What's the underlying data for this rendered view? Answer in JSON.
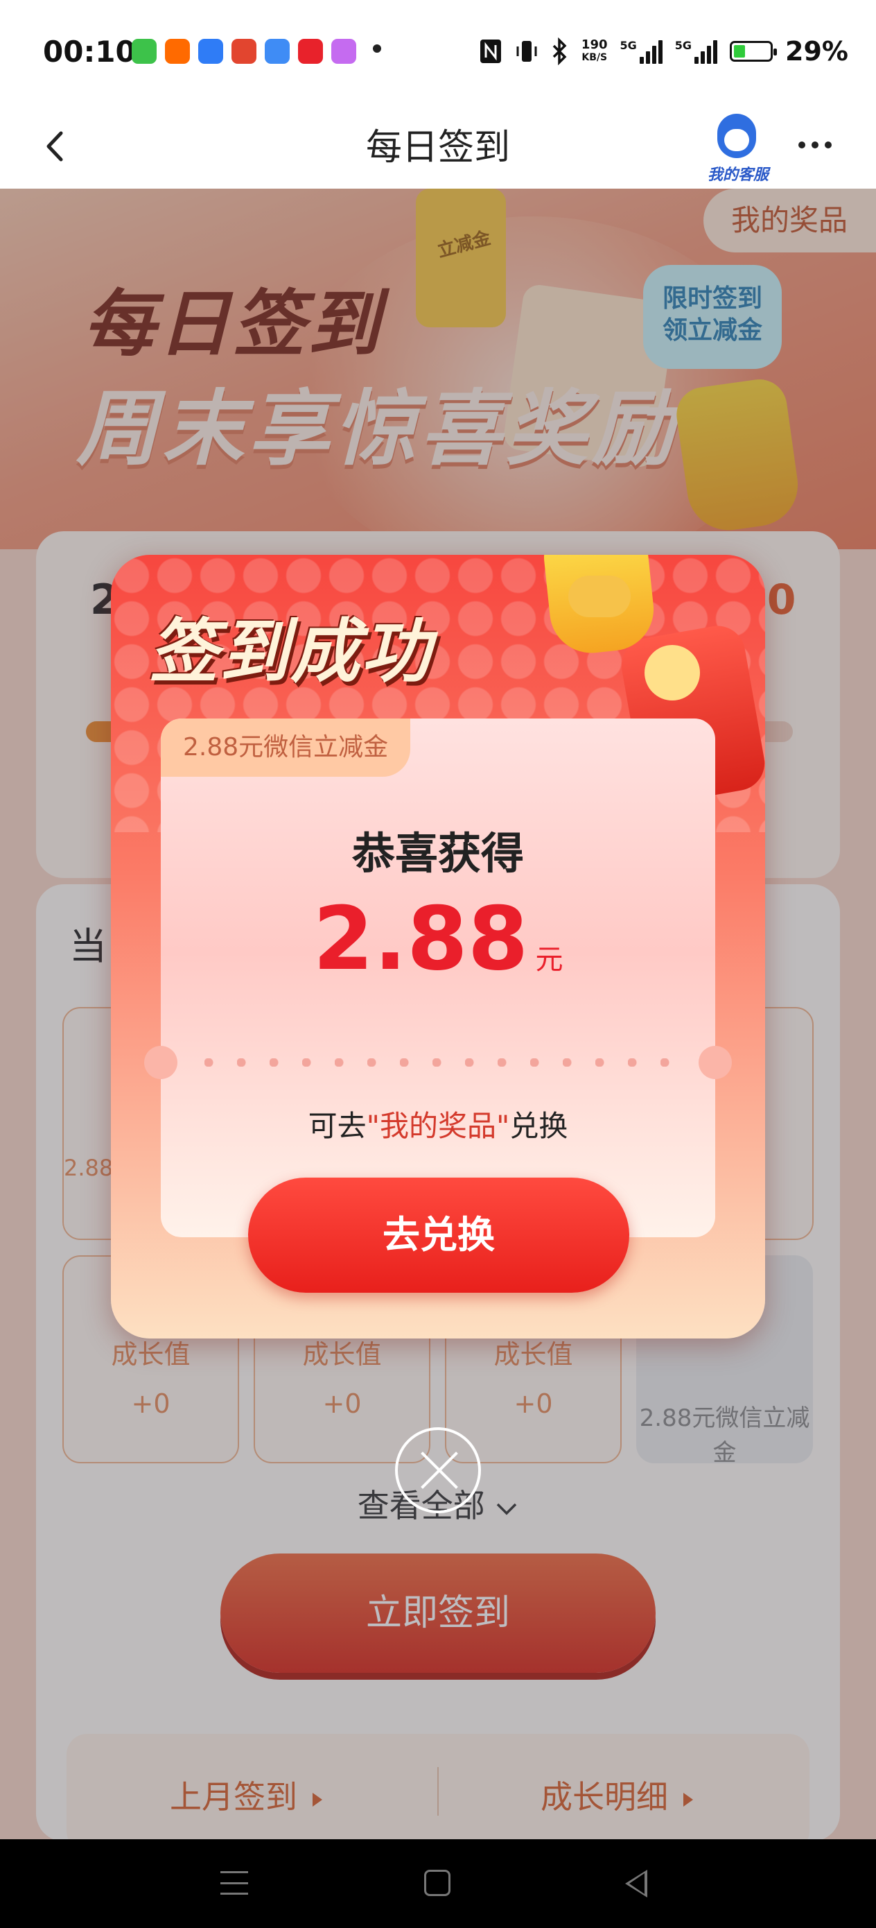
{
  "status_bar": {
    "time": "00:10",
    "net_speed_value": "190",
    "net_speed_unit": "KB/S",
    "network_label_1": "5G",
    "network_label_2": "5G",
    "battery": "29%",
    "app_icon_colors": [
      "#3dc24a",
      "#ff6a00",
      "#2f7cf6",
      "#e2452f",
      "#3f8cf5",
      "#e8222b",
      "#c56bf0"
    ]
  },
  "nav": {
    "title": "每日签到",
    "customer_service": "我的客服"
  },
  "banner": {
    "title_line1": "每日签到",
    "title_line2": "周末享惊喜奖励",
    "my_prizes": "我的奖品",
    "limited_line1": "限时签到",
    "limited_line2": "领立减金",
    "coin_label": "立减金"
  },
  "checkin": {
    "day_left": "2",
    "day_right": "10"
  },
  "rewards": {
    "heading_partial": "当",
    "left_partial": "2.88",
    "cells": [
      {
        "label": "成长值",
        "value": "+0"
      },
      {
        "label": "成长值",
        "value": "+0"
      },
      {
        "label": "成长值",
        "value": "+0"
      }
    ],
    "grey_cell_text": "2.88元微信立减金",
    "view_all": "查看全部",
    "sign_now": "立即签到",
    "last_month": "上月签到",
    "growth_detail": "成长明细"
  },
  "modal": {
    "title": "签到成功",
    "tag": "2.88元微信立减金",
    "heading": "恭喜获得",
    "amount": "2.88",
    "unit": "元",
    "hint_prefix": "可去",
    "hint_highlight": "\"我的奖品\"",
    "hint_suffix": "兑换",
    "redeem_button": "去兑换"
  }
}
